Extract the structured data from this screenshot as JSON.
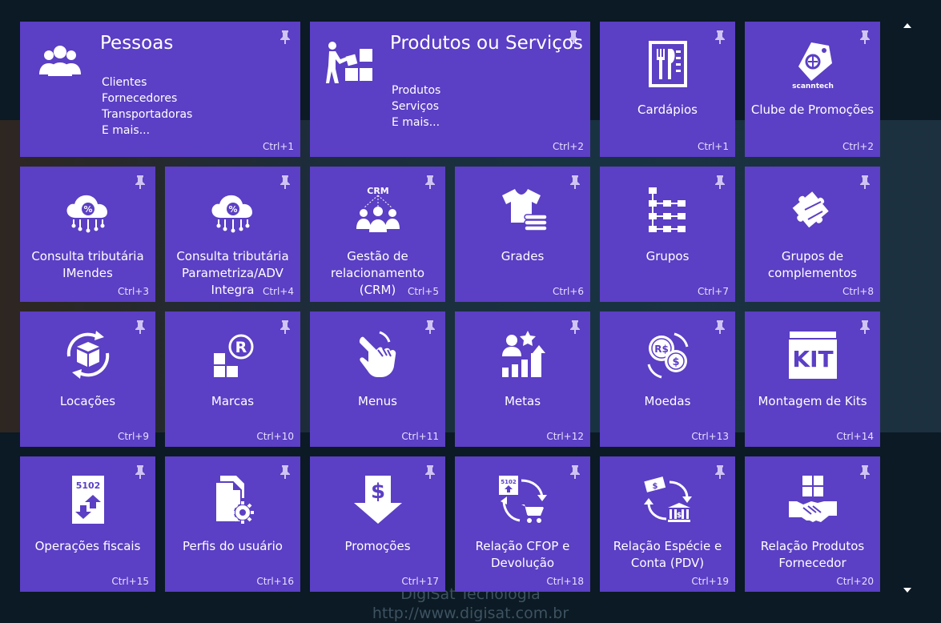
{
  "background": {
    "footer_company": "DigiSat Tecnologia",
    "footer_url": "http://www.digisat.com.br"
  },
  "colors": {
    "tile": "#5b3fc4",
    "page": "#0b1a24"
  },
  "wide_tiles": [
    {
      "title": "Pessoas",
      "lines": [
        "Clientes",
        "Fornecedores",
        "Transportadoras",
        "E mais..."
      ],
      "shortcut": "Ctrl+1",
      "icon": "people-icon"
    },
    {
      "title": "Produtos ou Serviços",
      "lines": [
        "Produtos",
        "Serviços",
        "E mais..."
      ],
      "shortcut": "Ctrl+2",
      "icon": "products-icon"
    }
  ],
  "tiles": [
    {
      "label": "Cardápios",
      "shortcut": "Ctrl+1",
      "icon": "menu-card-icon"
    },
    {
      "label": "Clube de Promoções",
      "shortcut": "Ctrl+2",
      "icon": "scanntech-tag-icon",
      "brand": "scanntech"
    },
    {
      "label": "Consulta tributária IMendes",
      "shortcut": "Ctrl+3",
      "icon": "tax-cloud-icon"
    },
    {
      "label": "Consulta tributária Parametriza/ADV Integra",
      "shortcut": "Ctrl+4",
      "icon": "tax-cloud-icon"
    },
    {
      "label": "Gestão de relacionamento (CRM)",
      "shortcut": "Ctrl+5",
      "icon": "crm-icon",
      "icon_text": "CRM"
    },
    {
      "label": "Grades",
      "shortcut": "Ctrl+6",
      "icon": "tshirt-icon"
    },
    {
      "label": "Grupos",
      "shortcut": "Ctrl+7",
      "icon": "groups-tree-icon"
    },
    {
      "label": "Grupos de complementos",
      "shortcut": "Ctrl+8",
      "icon": "puzzle-icon"
    },
    {
      "label": "Locações",
      "shortcut": "Ctrl+9",
      "icon": "box-cycle-icon"
    },
    {
      "label": "Marcas",
      "shortcut": "Ctrl+10",
      "icon": "registered-icon"
    },
    {
      "label": "Menus",
      "shortcut": "Ctrl+11",
      "icon": "touch-hand-icon"
    },
    {
      "label": "Metas",
      "shortcut": "Ctrl+12",
      "icon": "goals-chart-icon"
    },
    {
      "label": "Moedas",
      "shortcut": "Ctrl+13",
      "icon": "coins-icon",
      "icon_text": "R$"
    },
    {
      "label": "Montagem de Kits",
      "shortcut": "Ctrl+14",
      "icon": "kit-icon",
      "icon_text": "KIT"
    },
    {
      "label": "Operações fiscais",
      "shortcut": "Ctrl+15",
      "icon": "fiscal-doc-icon",
      "icon_text": "5102"
    },
    {
      "label": "Perfis do usuário",
      "shortcut": "Ctrl+16",
      "icon": "user-profile-doc-icon"
    },
    {
      "label": "Promoções",
      "shortcut": "Ctrl+17",
      "icon": "promo-dollar-icon"
    },
    {
      "label": "Relação CFOP e Devolução",
      "shortcut": "Ctrl+18",
      "icon": "cfop-cart-icon",
      "icon_text": "5102"
    },
    {
      "label": "Relação Espécie e Conta (PDV)",
      "shortcut": "Ctrl+19",
      "icon": "cash-bank-icon"
    },
    {
      "label": "Relação Produtos Fornecedor",
      "shortcut": "Ctrl+20",
      "icon": "handshake-icon"
    }
  ]
}
